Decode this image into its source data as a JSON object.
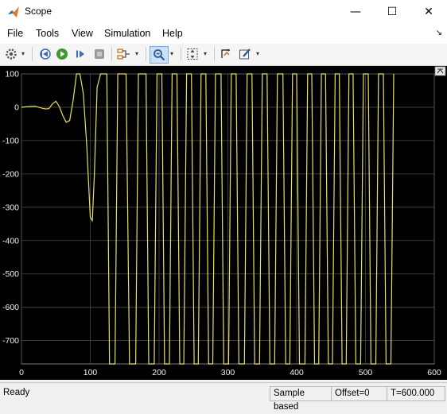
{
  "window": {
    "title": "Scope"
  },
  "window_controls": {
    "minimize": "—",
    "maximize": "☐",
    "close": "✕"
  },
  "menu": [
    "File",
    "Tools",
    "View",
    "Simulation",
    "Help"
  ],
  "toolbar": {
    "buttons": [
      "settings-icon",
      "step-back-icon",
      "run-icon",
      "step-forward-icon",
      "stop-icon",
      "signal-selector-icon",
      "zoom-icon",
      "scale-axes-icon",
      "cursor-measure-icon",
      "highlight-icon"
    ],
    "dropdown": "▾"
  },
  "status": {
    "ready": "Ready",
    "sample": "Sample based",
    "offset": "Offset=0",
    "time": "T=600.000"
  },
  "chart_data": {
    "type": "line",
    "title": "",
    "xlabel": "",
    "ylabel": "",
    "xlim": [
      0,
      600
    ],
    "ylim": [
      -770,
      100
    ],
    "grid": true,
    "x_ticks": [
      "0",
      "100",
      "200",
      "300",
      "400",
      "500",
      "600"
    ],
    "y_ticks": [
      "100",
      "0",
      "-100",
      "-200",
      "-300",
      "-400",
      "-500",
      "-600",
      "-700"
    ],
    "line_color": "#e8e060",
    "series": [
      {
        "x": [
          0,
          10,
          20,
          30,
          35,
          40,
          45,
          50,
          55,
          60,
          65,
          70,
          75,
          80,
          85,
          90,
          95,
          100,
          103,
          106,
          110,
          115,
          120,
          124,
          128,
          136,
          140,
          152,
          157,
          166,
          170,
          181,
          185,
          193,
          197,
          204,
          208,
          215,
          219,
          226,
          230,
          236,
          240,
          247,
          251,
          257,
          261,
          268,
          272,
          278,
          282,
          290,
          294,
          301,
          305,
          312,
          316,
          324,
          328,
          335,
          339,
          346,
          350,
          357,
          361,
          368,
          372,
          380,
          384,
          390,
          394,
          400,
          404,
          412,
          416,
          422,
          426,
          432,
          436,
          442,
          446,
          452,
          456,
          462,
          466,
          472,
          476,
          482,
          486,
          493,
          497,
          504,
          508,
          515,
          519,
          526,
          530,
          537,
          541
        ],
        "y": [
          0,
          2,
          3,
          -3,
          -5,
          -4,
          10,
          18,
          2,
          -25,
          -45,
          -40,
          20,
          100,
          100,
          40,
          -120,
          -330,
          -340,
          -200,
          60,
          100,
          100,
          100,
          -770,
          -770,
          100,
          100,
          -770,
          -770,
          100,
          100,
          -770,
          -770,
          100,
          100,
          -770,
          -770,
          100,
          100,
          -770,
          -770,
          100,
          100,
          -770,
          -770,
          100,
          100,
          -770,
          -770,
          100,
          100,
          -770,
          -770,
          100,
          100,
          -770,
          -770,
          100,
          100,
          -770,
          -770,
          100,
          100,
          -770,
          -770,
          100,
          100,
          -770,
          -770,
          100,
          100,
          -770,
          -770,
          100,
          100,
          -770,
          -770,
          100,
          100,
          -770,
          -770,
          100,
          100,
          -770,
          -770,
          100,
          100,
          -770,
          -770,
          100,
          100,
          -770,
          -770,
          100,
          100,
          -770,
          -770,
          100
        ]
      }
    ]
  }
}
